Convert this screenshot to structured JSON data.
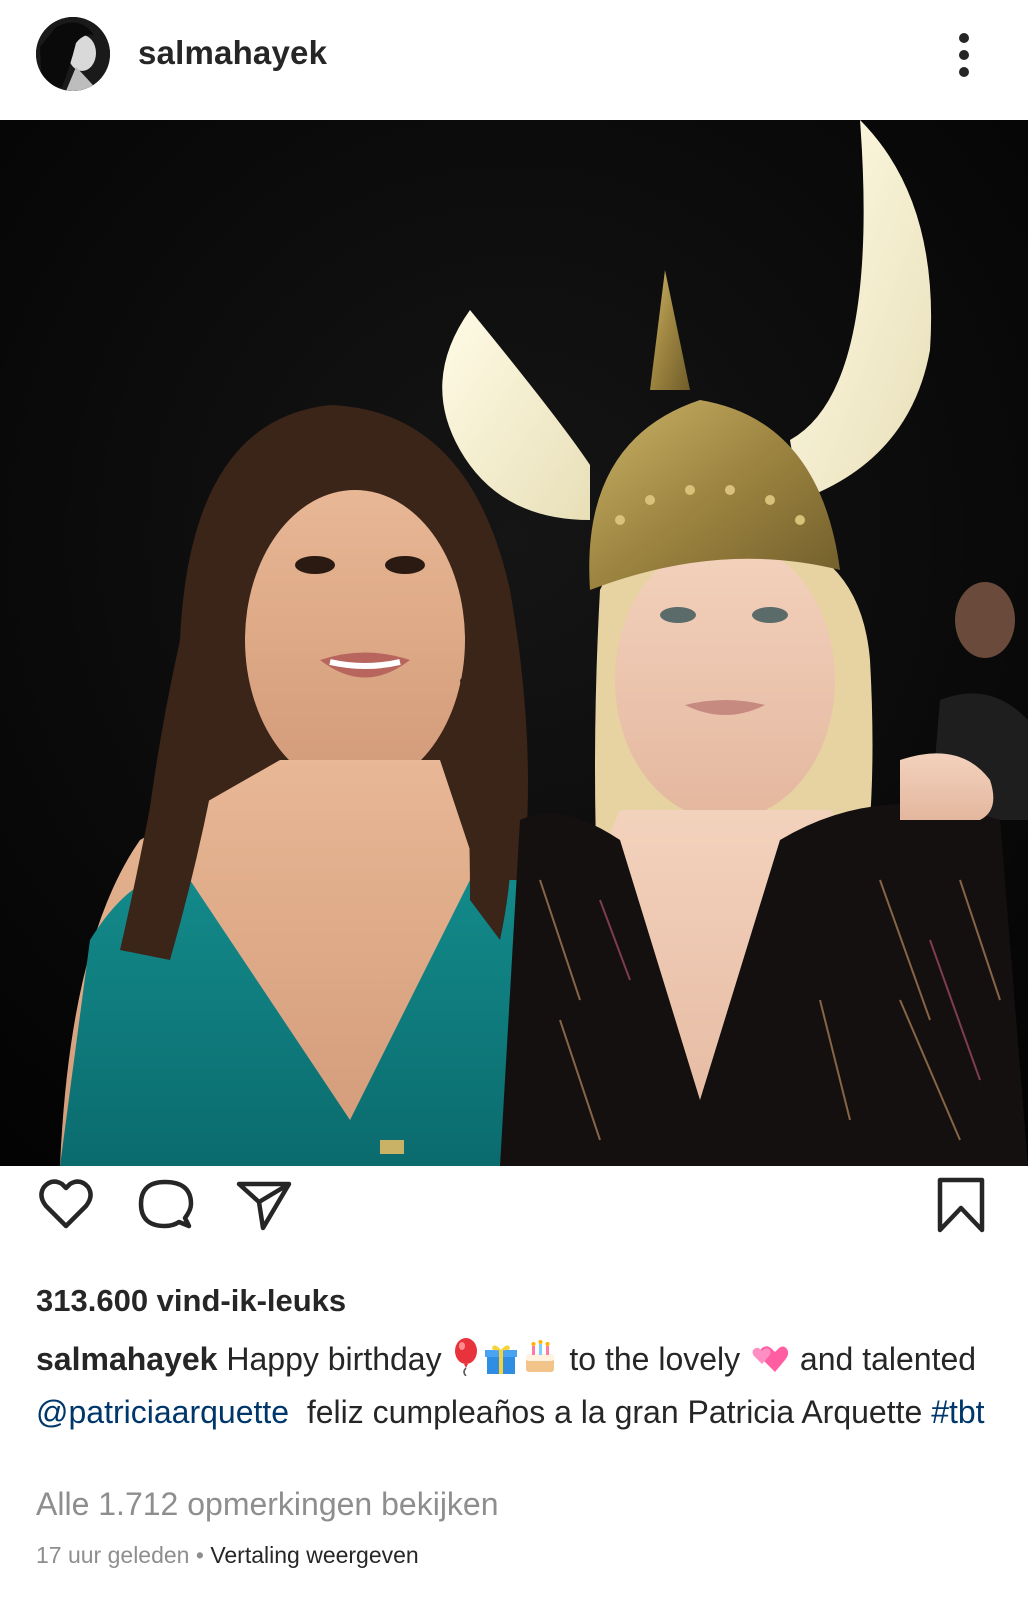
{
  "post": {
    "username": "salmahayek",
    "avatar_icon": "profile-avatar",
    "more_icon": "more-vertical-icon",
    "photo_description_icon": "post-photo"
  },
  "actions": {
    "like_icon": "heart-icon",
    "comment_icon": "comment-icon",
    "share_icon": "share-icon",
    "save_icon": "bookmark-icon"
  },
  "likes": {
    "text": "313.600 vind-ik-leuks"
  },
  "caption": {
    "username": "salmahayek",
    "text_1": "Happy birthday",
    "emojis_1": [
      "balloon",
      "gift",
      "birthday-cake"
    ],
    "text_2": "to the lovely",
    "emojis_2": [
      "two-hearts"
    ],
    "text_3": "and talented",
    "mention": "@patriciaarquette",
    "text_4": "feliz cumpleaños a la gran Patricia Arquette",
    "hashtag": "#tbt"
  },
  "comments": {
    "view_all": "Alle 1.712 opmerkingen bekijken"
  },
  "meta": {
    "time": "17 uur geleden",
    "separator": "•",
    "translate": "Vertaling weergeven"
  },
  "colors": {
    "text": "#262626",
    "muted": "#8e8e8e",
    "link": "#00376b"
  }
}
